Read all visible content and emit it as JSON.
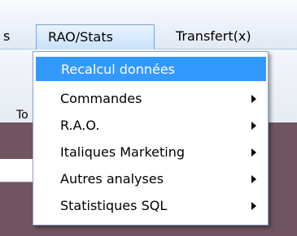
{
  "menubar": {
    "partial_label": "s",
    "rao_stats_label": "RAO/Stats",
    "transfert_label": "Transfert(x)"
  },
  "toolbar": {
    "partial_label": "To"
  },
  "dropdown": {
    "items": [
      {
        "label": "Recalcul données",
        "has_submenu": false
      },
      {
        "label": "Commandes",
        "has_submenu": true
      },
      {
        "label": "R.A.O.",
        "has_submenu": true
      },
      {
        "label": "Italiques Marketing",
        "has_submenu": true
      },
      {
        "label": "Autres analyses",
        "has_submenu": true
      },
      {
        "label": "Statistiques SQL",
        "has_submenu": true
      }
    ]
  },
  "colors": {
    "highlight": "#3399ff",
    "background_panel": "#705460"
  }
}
